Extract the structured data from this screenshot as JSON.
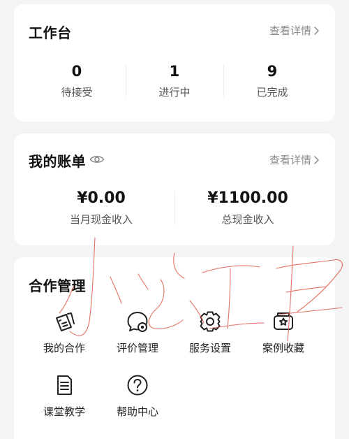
{
  "workbench": {
    "title": "工作台",
    "detail_link": "查看详情",
    "stats": [
      {
        "value": "0",
        "label": "待接受"
      },
      {
        "value": "1",
        "label": "进行中"
      },
      {
        "value": "9",
        "label": "已完成"
      }
    ]
  },
  "bill": {
    "title": "我的账单",
    "detail_link": "查看详情",
    "stats": [
      {
        "value": "¥0.00",
        "label": "当月现金收入"
      },
      {
        "value": "¥1100.00",
        "label": "总现金收入"
      }
    ]
  },
  "cooperation": {
    "title": "合作管理",
    "items": [
      {
        "label": "我的合作",
        "icon": "cards-icon"
      },
      {
        "label": "评价管理",
        "icon": "chat-bubble-icon"
      },
      {
        "label": "服务设置",
        "icon": "settings-icon"
      },
      {
        "label": "案例收藏",
        "icon": "star-box-icon"
      },
      {
        "label": "课堂教学",
        "icon": "document-icon"
      },
      {
        "label": "帮助中心",
        "icon": "question-icon"
      }
    ]
  },
  "colors": {
    "background": "#f4f4f4",
    "card": "#ffffff",
    "muted_text": "#8a8a8a",
    "watermark": "#e0584a"
  }
}
